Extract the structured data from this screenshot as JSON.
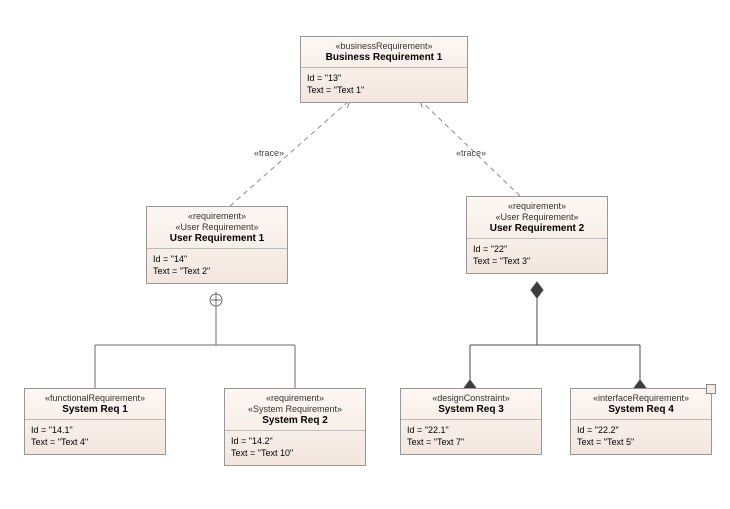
{
  "labels": {
    "trace_left": "«trace»",
    "trace_right": "«trace»"
  },
  "nodes": {
    "biz1": {
      "stereos": [
        "«businessRequirement»"
      ],
      "title": "Business Requirement 1",
      "id_line": "Id = \"13\"",
      "text_line": "Text = \"Text 1\""
    },
    "user1": {
      "stereos": [
        "«requirement»",
        "«User Requirement»"
      ],
      "title": "User Requirement 1",
      "id_line": "Id = \"14\"",
      "text_line": "Text = \"Text 2\""
    },
    "user2": {
      "stereos": [
        "«requirement»",
        "«User Requirement»"
      ],
      "title": "User Requirement 2",
      "id_line": "Id = \"22\"",
      "text_line": "Text = \"Text 3\""
    },
    "sys1": {
      "stereos": [
        "«functionalRequirement»"
      ],
      "title": "System Req 1",
      "id_line": "Id = \"14.1\"",
      "text_line": "Text = \"Text 4\""
    },
    "sys2": {
      "stereos": [
        "«requirement»",
        "«System Requirement»"
      ],
      "title": "System Req 2",
      "id_line": "Id = \"14.2\"",
      "text_line": "Text = \"Text 10\""
    },
    "sys3": {
      "stereos": [
        "«designConstraint»"
      ],
      "title": "System Req 3",
      "id_line": "Id = \"22.1\"",
      "text_line": "Text = \"Text 7\""
    },
    "sys4": {
      "stereos": [
        "«interfaceRequirement»"
      ],
      "title": "System Req 4",
      "id_line": "Id = \"22.2\"",
      "text_line": "Text = \"Text  5\""
    }
  }
}
